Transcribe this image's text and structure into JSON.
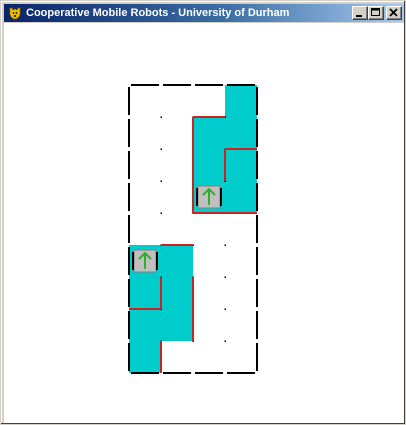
{
  "window": {
    "title": "Cooperative Mobile Robots - University of Durham",
    "icon": "dog-head-icon",
    "buttons": {
      "minimize": "minimize-icon",
      "maximize": "maximize-icon",
      "close": "close-icon"
    }
  },
  "colors": {
    "explored": "#00cccc",
    "wall": "#000000",
    "red_wall": "#cc2222",
    "robot_body": "#c0c0c0",
    "robot_arrow": "#33aa33",
    "background": "#ffffff"
  },
  "grid": {
    "cols": 4,
    "rows": 9,
    "explored_cells": [
      [
        3,
        0
      ],
      [
        2,
        1
      ],
      [
        3,
        1
      ],
      [
        2,
        2
      ],
      [
        3,
        2
      ],
      [
        2,
        3
      ],
      [
        3,
        3
      ],
      [
        0,
        5
      ],
      [
        1,
        5
      ],
      [
        0,
        6
      ],
      [
        1,
        6
      ],
      [
        0,
        7
      ],
      [
        1,
        7
      ],
      [
        0,
        8
      ]
    ],
    "red_segments": [
      {
        "orient": "v",
        "col": 2,
        "row": 1
      },
      {
        "orient": "v",
        "col": 2,
        "row": 2
      },
      {
        "orient": "v",
        "col": 2,
        "row": 3
      },
      {
        "orient": "h",
        "col": 2,
        "row": 1
      },
      {
        "orient": "h",
        "col": 3,
        "row": 2
      },
      {
        "orient": "v",
        "col": 3,
        "row": 2
      },
      {
        "orient": "h",
        "col": 2,
        "row": 4
      },
      {
        "orient": "h",
        "col": 3,
        "row": 4
      },
      {
        "orient": "h",
        "col": 1,
        "row": 5
      },
      {
        "orient": "v",
        "col": 1,
        "row": 6
      },
      {
        "orient": "v",
        "col": 2,
        "row": 6
      },
      {
        "orient": "v",
        "col": 2,
        "row": 7
      },
      {
        "orient": "v",
        "col": 1,
        "row": 8
      },
      {
        "orient": "h",
        "col": 0,
        "row": 7
      }
    ],
    "robots": [
      {
        "col": 2,
        "row": 3,
        "heading": "up"
      },
      {
        "col": 0,
        "row": 5,
        "heading": "up"
      }
    ]
  }
}
